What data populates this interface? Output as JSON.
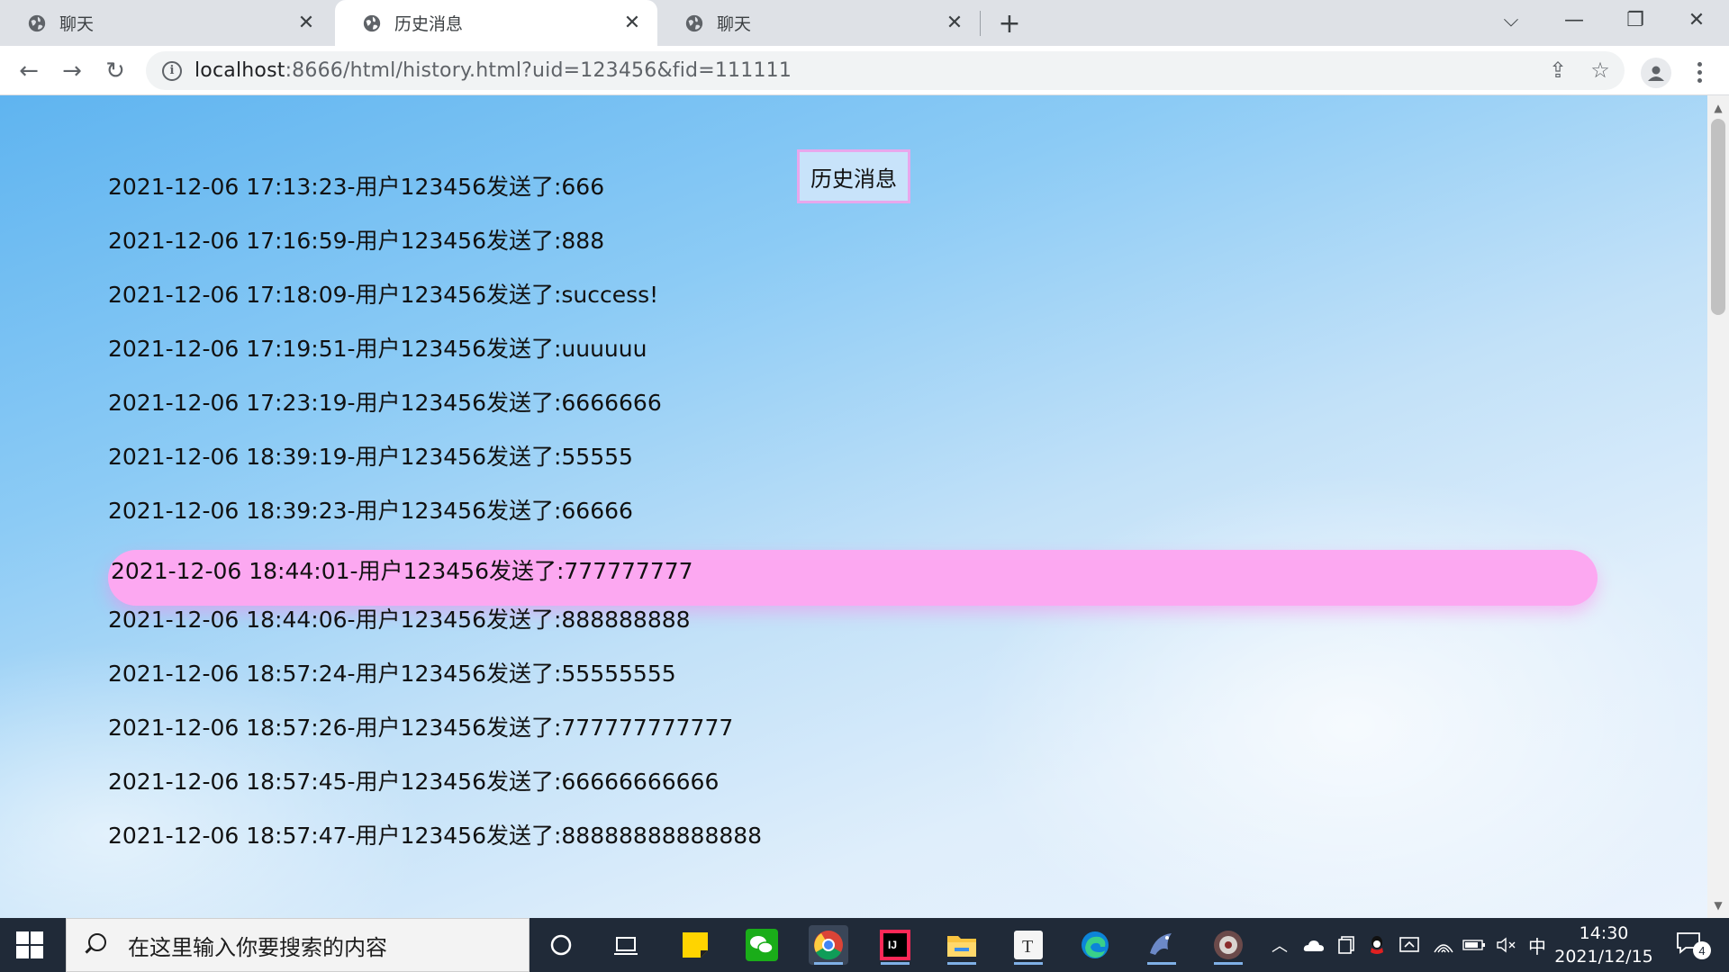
{
  "browser": {
    "tabs": [
      {
        "label": "聊天",
        "active": false
      },
      {
        "label": "历史消息",
        "active": true
      },
      {
        "label": "聊天",
        "active": false
      }
    ],
    "url_host": "localhost",
    "url_rest": ":8666/html/history.html?uid=123456&fid=111111"
  },
  "page": {
    "title_button": "历史消息",
    "messages": [
      "2021-12-06 17:13:23-用户123456发送了:666",
      "2021-12-06 17:16:59-用户123456发送了:888",
      "2021-12-06 17:18:09-用户123456发送了:success!",
      "2021-12-06 17:19:51-用户123456发送了:uuuuuu",
      "2021-12-06 17:23:19-用户123456发送了:6666666",
      "2021-12-06 18:39:19-用户123456发送了:55555",
      "2021-12-06 18:39:23-用户123456发送了:66666",
      "2021-12-06 18:44:01-用户123456发送了:777777777",
      "2021-12-06 18:44:06-用户123456发送了:888888888",
      "2021-12-06 18:57:24-用户123456发送了:55555555",
      "2021-12-06 18:57:26-用户123456发送了:777777777777",
      "2021-12-06 18:57:45-用户123456发送了:66666666666",
      "2021-12-06 18:57:47-用户123456发送了:88888888888888"
    ],
    "highlighted_index": 7
  },
  "taskbar": {
    "search_placeholder": "在这里输入你要搜索的内容",
    "ime": "中",
    "time": "14:30",
    "date": "2021/12/15",
    "notification_count": "4"
  },
  "colors": {
    "highlight": "#fca8f1",
    "title_border": "#e8a7ec"
  }
}
